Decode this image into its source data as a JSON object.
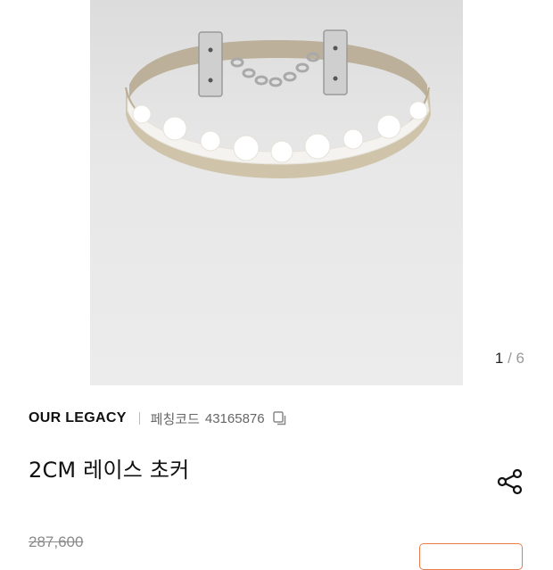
{
  "gallery": {
    "image_alt": "choker product photo",
    "counter": {
      "current": "1",
      "separator": "/",
      "total": "6"
    }
  },
  "product": {
    "brand": "OUR LEGACY",
    "code_label": "페칭코드",
    "code_value": "43165876",
    "title": "2CM 레이스 초커",
    "original_price": "287,600"
  },
  "colors": {
    "accent": "#ec7a4a",
    "muted_text": "#8a8a8a"
  },
  "icons": {
    "copy": "copy-icon",
    "share": "share-icon"
  }
}
